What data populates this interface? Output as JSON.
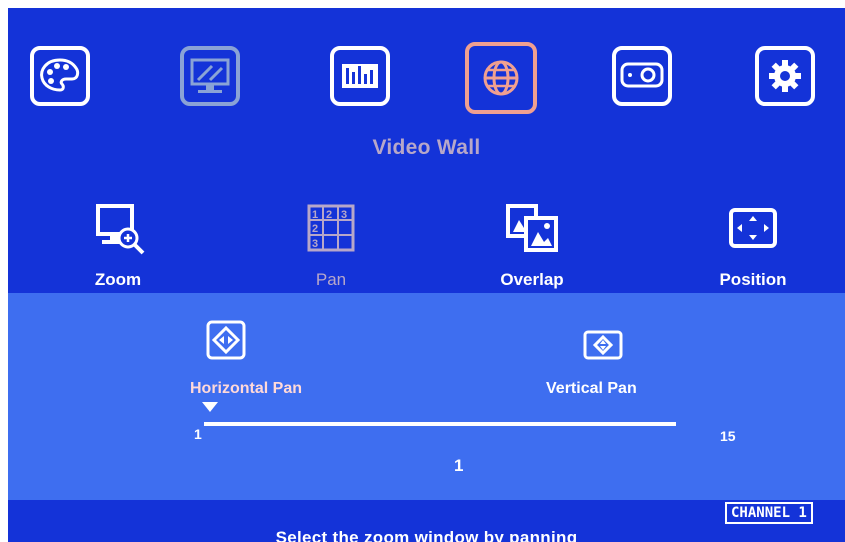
{
  "top_menu": {
    "items": [
      {
        "name": "palette-icon",
        "state": "normal"
      },
      {
        "name": "monitor-tools-icon",
        "state": "dim"
      },
      {
        "name": "equalizer-icon",
        "state": "normal"
      },
      {
        "name": "globe-icon",
        "state": "selected"
      },
      {
        "name": "projector-icon",
        "state": "normal"
      },
      {
        "name": "gear-icon",
        "state": "normal"
      }
    ],
    "title": "Video Wall"
  },
  "submenu": {
    "items": [
      {
        "label": "Zoom",
        "icon": "zoom-icon",
        "state": "normal"
      },
      {
        "label": "Pan",
        "icon": "grid-icon",
        "state": "dim"
      },
      {
        "label": "Overlap",
        "icon": "overlap-icon",
        "state": "normal"
      },
      {
        "label": "Position",
        "icon": "position-icon",
        "state": "normal"
      }
    ]
  },
  "pan": {
    "horizontal_label": "Horizontal Pan",
    "vertical_label": "Vertical Pan",
    "selected": "horizontal",
    "slider": {
      "min": "1",
      "max": "15",
      "value": "1"
    }
  },
  "status": {
    "hint": "Select the zoom window by panning",
    "channel": "CHANNEL 1"
  },
  "colors": {
    "background": "#1433d8",
    "panel": "#3e6ef0",
    "selected_border": "#f0a090",
    "dim": "#b7a7c9"
  }
}
